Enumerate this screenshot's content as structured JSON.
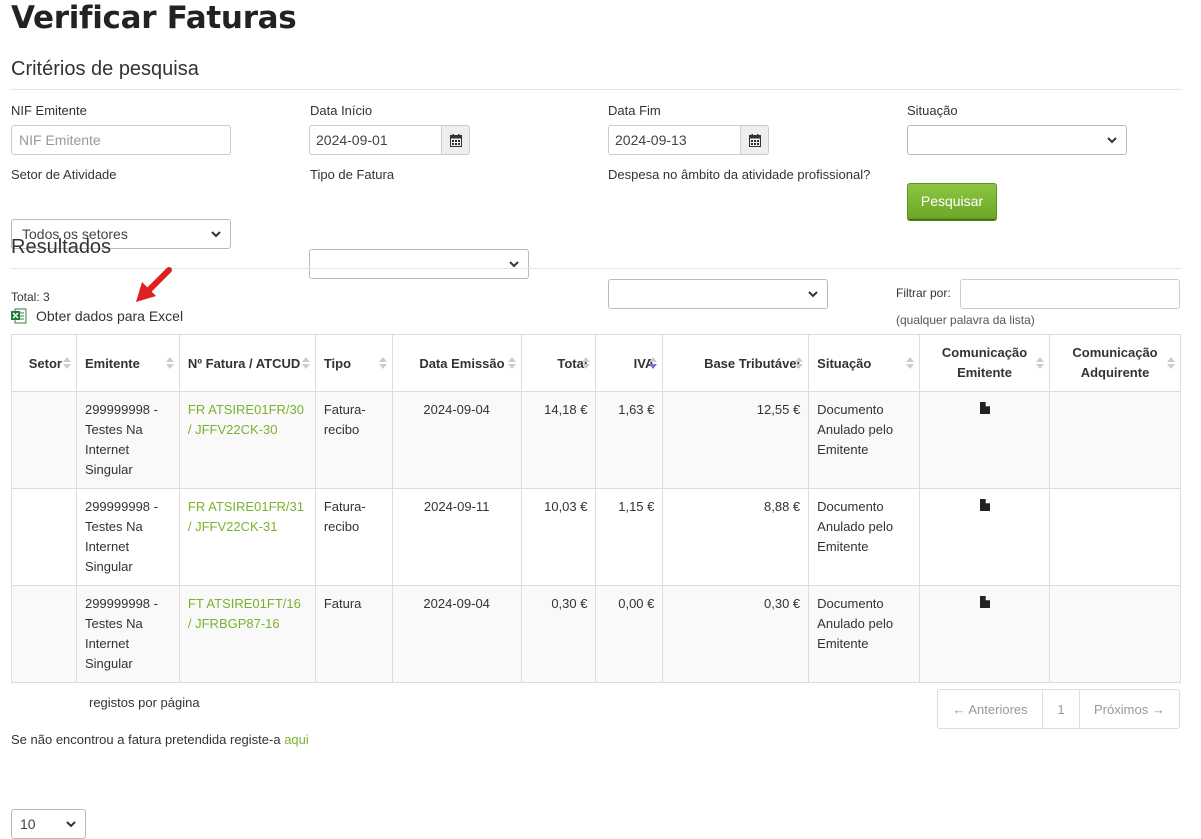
{
  "page": {
    "title": "Verificar Faturas"
  },
  "criteria": {
    "heading": "Critérios de pesquisa",
    "nif": {
      "label": "NIF Emitente",
      "placeholder": "NIF Emitente"
    },
    "data_inicio": {
      "label": "Data Início",
      "value": "2024-09-01"
    },
    "data_fim": {
      "label": "Data Fim",
      "value": "2024-09-13"
    },
    "situacao": {
      "label": "Situação",
      "value": ""
    },
    "setor": {
      "label": "Setor de Atividade",
      "value": "Todos os setores"
    },
    "tipo": {
      "label": "Tipo de Fatura",
      "value": ""
    },
    "despesa": {
      "label": "Despesa no âmbito da atividade profissional?",
      "value": ""
    },
    "search_button": "Pesquisar"
  },
  "results": {
    "heading": "Resultados",
    "total": "Total: 3",
    "excel_link": "Obter dados para Excel",
    "filter_label": "Filtrar por:",
    "filter_hint": "(qualquer palavra da lista)",
    "columns": [
      "Setor",
      "Emitente",
      "Nº Fatura / ATCUD",
      "Tipo",
      "Data Emissão",
      "Total",
      "IVA",
      "Base Tributável",
      "Situação",
      "Comunicação Emitente",
      "Comunicação Adquirente"
    ],
    "rows": [
      {
        "setor": "",
        "emitente": "299999998 - Testes Na Internet Singular",
        "fatura": "FR ATSIRE01FR/30 / JFFV22CK-30",
        "tipo": "Fatura-recibo",
        "data": "2024-09-04",
        "total": "14,18 €",
        "iva": "1,63 €",
        "base": "12,55 €",
        "situacao": "Documento Anulado pelo Emitente",
        "adquirente": ""
      },
      {
        "setor": "",
        "emitente": "299999998 - Testes Na Internet Singular",
        "fatura": "FR ATSIRE01FR/31 / JFFV22CK-31",
        "tipo": "Fatura-recibo",
        "data": "2024-09-11",
        "total": "10,03 €",
        "iva": "1,15 €",
        "base": "8,88 €",
        "situacao": "Documento Anulado pelo Emitente",
        "adquirente": ""
      },
      {
        "setor": "",
        "emitente": "299999998 - Testes Na Internet Singular",
        "fatura": "FT ATSIRE01FT/16 / JFRBGP87-16",
        "tipo": "Fatura",
        "data": "2024-09-04",
        "total": "0,30 €",
        "iva": "0,00 €",
        "base": "0,30 €",
        "situacao": "Documento Anulado pelo Emitente",
        "adquirente": ""
      }
    ],
    "page_size": "10",
    "page_size_label": "registos por página",
    "pager": {
      "prev": "← Anteriores",
      "page": "1",
      "next": "Próximos →"
    },
    "footer_text": "Se não encontrou a fatura pretendida registe-a ",
    "footer_link": "aqui"
  },
  "colors": {
    "accent_green": "#7ab230",
    "button_green": "#7cb733",
    "arrow_red": "#e02020"
  },
  "icons": [
    "calendar-icon",
    "chevron-down-icon",
    "excel-icon",
    "document-icon",
    "arrow-annotation-icon"
  ]
}
